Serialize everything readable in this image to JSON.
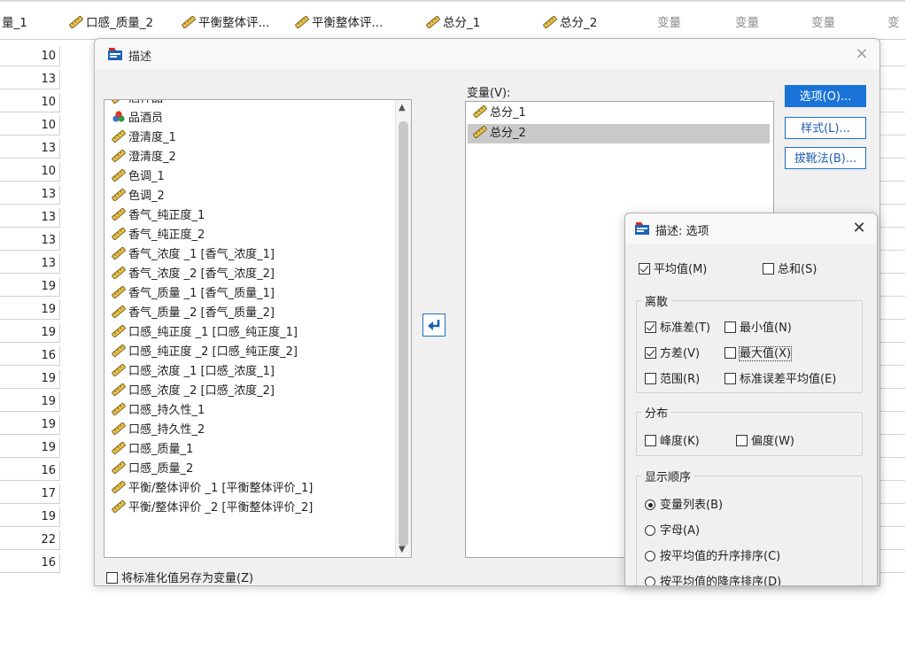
{
  "sheet": {
    "column_headers": [
      {
        "label": "量_1",
        "pencil": false,
        "dim": false
      },
      {
        "label": "口感_质量_2",
        "pencil": true,
        "dim": false
      },
      {
        "label": "平衡整体评...",
        "pencil": true,
        "dim": false
      },
      {
        "label": "平衡整体评...",
        "pencil": true,
        "dim": false
      },
      {
        "label": "总分_1",
        "pencil": true,
        "dim": false
      },
      {
        "label": "总分_2",
        "pencil": true,
        "dim": false
      },
      {
        "label": "变量",
        "pencil": false,
        "dim": true
      },
      {
        "label": "变量",
        "pencil": false,
        "dim": true
      },
      {
        "label": "变量",
        "pencil": false,
        "dim": true
      },
      {
        "label": "变",
        "pencil": false,
        "dim": true
      }
    ],
    "row_values": [
      "10",
      "13",
      "10",
      "10",
      "13",
      "10",
      "13",
      "13",
      "13",
      "13",
      "19",
      "19",
      "19",
      "16",
      "19",
      "19",
      "19",
      "19",
      "16",
      "17",
      "19",
      "22",
      "16"
    ]
  },
  "dialog": {
    "title": "描述",
    "close_glyph": "×",
    "source_items": [
      {
        "label": "酒样品",
        "icon": "ruler"
      },
      {
        "label": "品酒员",
        "icon": "nominal"
      },
      {
        "label": "澄清度_1",
        "icon": "ruler"
      },
      {
        "label": "澄清度_2",
        "icon": "ruler"
      },
      {
        "label": "色调_1",
        "icon": "ruler"
      },
      {
        "label": "色调_2",
        "icon": "ruler"
      },
      {
        "label": "香气_纯正度_1",
        "icon": "ruler"
      },
      {
        "label": "香气_纯正度_2",
        "icon": "ruler"
      },
      {
        "label": "香气_浓度 _1 [香气_浓度_1]",
        "icon": "ruler"
      },
      {
        "label": "香气_浓度 _2 [香气_浓度_2]",
        "icon": "ruler"
      },
      {
        "label": "香气_质量 _1 [香气_质量_1]",
        "icon": "ruler"
      },
      {
        "label": "香气_质量 _2 [香气_质量_2]",
        "icon": "ruler"
      },
      {
        "label": "口感_纯正度 _1 [口感_纯正度_1]",
        "icon": "ruler"
      },
      {
        "label": "口感_纯正度 _2 [口感_纯正度_2]",
        "icon": "ruler"
      },
      {
        "label": "口感_浓度 _1 [口感_浓度_1]",
        "icon": "ruler"
      },
      {
        "label": "口感_浓度 _2 [口感_浓度_2]",
        "icon": "ruler"
      },
      {
        "label": "口感_持久性_1",
        "icon": "ruler"
      },
      {
        "label": "口感_持久性_2",
        "icon": "ruler"
      },
      {
        "label": "口感_质量_1",
        "icon": "ruler"
      },
      {
        "label": "口感_质量_2",
        "icon": "ruler"
      },
      {
        "label": "平衡/整体评价 _1 [平衡整体评价_1]",
        "icon": "ruler"
      },
      {
        "label": "平衡/整体评价 _2 [平衡整体评价_2]",
        "icon": "ruler"
      }
    ],
    "variables_label": "变量(V):",
    "target_items": [
      {
        "label": "总分_1",
        "selected": false
      },
      {
        "label": "总分_2",
        "selected": true
      }
    ],
    "buttons": {
      "options": "选项(O)...",
      "style": "样式(L)...",
      "bootstrap": "拔靴法(B)..."
    },
    "save_standardized": {
      "label": "将标准化值另存为变量(Z)",
      "checked": false
    }
  },
  "options_dialog": {
    "title": "描述: 选项",
    "close_glyph": "✕",
    "mean": {
      "label": "平均值(M)",
      "checked": true
    },
    "sum": {
      "label": "总和(S)",
      "checked": false
    },
    "dispersion": {
      "title": "离散",
      "std_dev": {
        "label": "标准差(T)",
        "checked": true
      },
      "minimum": {
        "label": "最小值(N)",
        "checked": false
      },
      "variance": {
        "label": "方差(V)",
        "checked": true
      },
      "maximum": {
        "label": "最大值(X)",
        "checked": false
      },
      "range": {
        "label": "范围(R)",
        "checked": false
      },
      "se_mean": {
        "label": "标准误差平均值(E)",
        "checked": false
      }
    },
    "distribution": {
      "title": "分布",
      "kurtosis": {
        "label": "峰度(K)",
        "checked": false
      },
      "skewness": {
        "label": "偏度(W)",
        "checked": false
      }
    },
    "display_order": {
      "title": "显示顺序",
      "options": [
        {
          "label": "变量列表(B)",
          "selected": true
        },
        {
          "label": "字母(A)",
          "selected": false
        },
        {
          "label": "按平均值的升序排序(C)",
          "selected": false
        },
        {
          "label": "按平均值的降序排序(D)",
          "selected": false
        }
      ]
    }
  },
  "colors": {
    "accent": "#1a73d9",
    "selected_row": "#c9c9c9"
  }
}
